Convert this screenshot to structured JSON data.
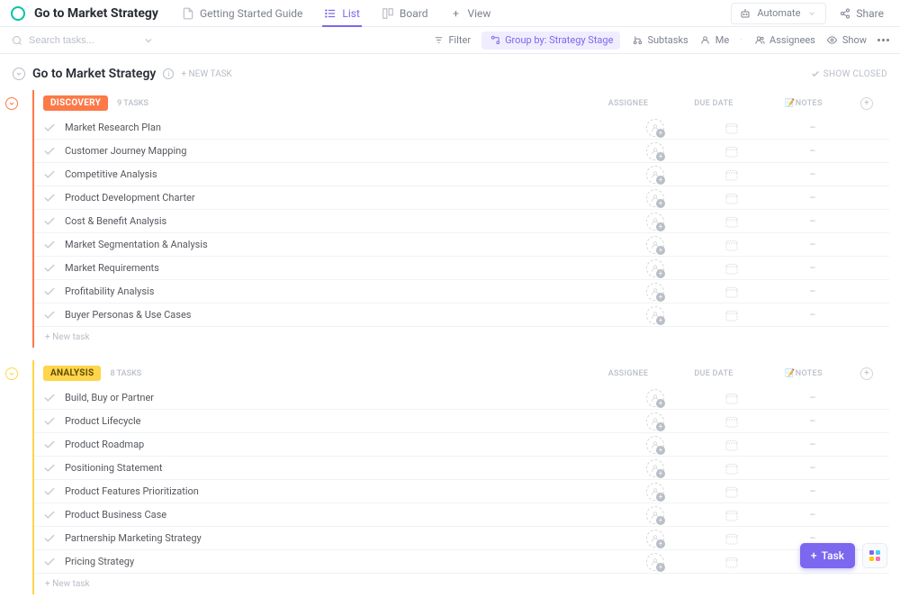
{
  "header": {
    "project_title": "Go to Market Strategy",
    "views": [
      {
        "label": "Getting Started Guide",
        "icon": "doc-icon"
      },
      {
        "label": "List",
        "icon": "list-icon",
        "active": true
      },
      {
        "label": "Board",
        "icon": "board-icon"
      },
      {
        "label": "View",
        "icon": "plus-icon"
      }
    ],
    "automate": "Automate",
    "share": "Share"
  },
  "toolbar": {
    "search_placeholder": "Search tasks...",
    "filter": "Filter",
    "group_by": "Group by: Strategy Stage",
    "subtasks": "Subtasks",
    "me": "Me",
    "assignees": "Assignees",
    "show": "Show"
  },
  "list": {
    "title": "Go to Market Strategy",
    "new_task": "+ NEW TASK",
    "show_closed": "SHOW CLOSED"
  },
  "columns": {
    "assignee": "ASSIGNEE",
    "due_date": "DUE DATE",
    "notes": "📝NOTES"
  },
  "groups": [
    {
      "name": "DISCOVERY",
      "count": "9 TASKS",
      "color": "#fd7948",
      "tasks": [
        {
          "name": "Market Research Plan",
          "notes": "–"
        },
        {
          "name": "Customer Journey Mapping",
          "notes": "–"
        },
        {
          "name": "Competitive Analysis",
          "notes": "–"
        },
        {
          "name": "Product Development Charter",
          "notes": "–"
        },
        {
          "name": "Cost & Benefit Analysis",
          "notes": "–"
        },
        {
          "name": "Market Segmentation & Analysis",
          "notes": "–"
        },
        {
          "name": "Market Requirements",
          "notes": "–"
        },
        {
          "name": "Profitability Analysis",
          "notes": "–"
        },
        {
          "name": "Buyer Personas & Use Cases",
          "notes": "–"
        }
      ],
      "new_task": "+ New task"
    },
    {
      "name": "ANALYSIS",
      "count": "8 TASKS",
      "color": "#ffd54a",
      "tasks": [
        {
          "name": "Build, Buy or Partner",
          "notes": "–"
        },
        {
          "name": "Product Lifecycle",
          "notes": "–"
        },
        {
          "name": "Product Roadmap",
          "notes": "–"
        },
        {
          "name": "Positioning Statement",
          "notes": "–"
        },
        {
          "name": "Product Features Prioritization",
          "notes": "–"
        },
        {
          "name": "Product Business Case",
          "notes": "–"
        },
        {
          "name": "Partnership Marketing Strategy",
          "notes": "–"
        },
        {
          "name": "Pricing Strategy",
          "notes": "–"
        }
      ],
      "new_task": "+ New task"
    }
  ],
  "fab": {
    "task": "Task"
  }
}
